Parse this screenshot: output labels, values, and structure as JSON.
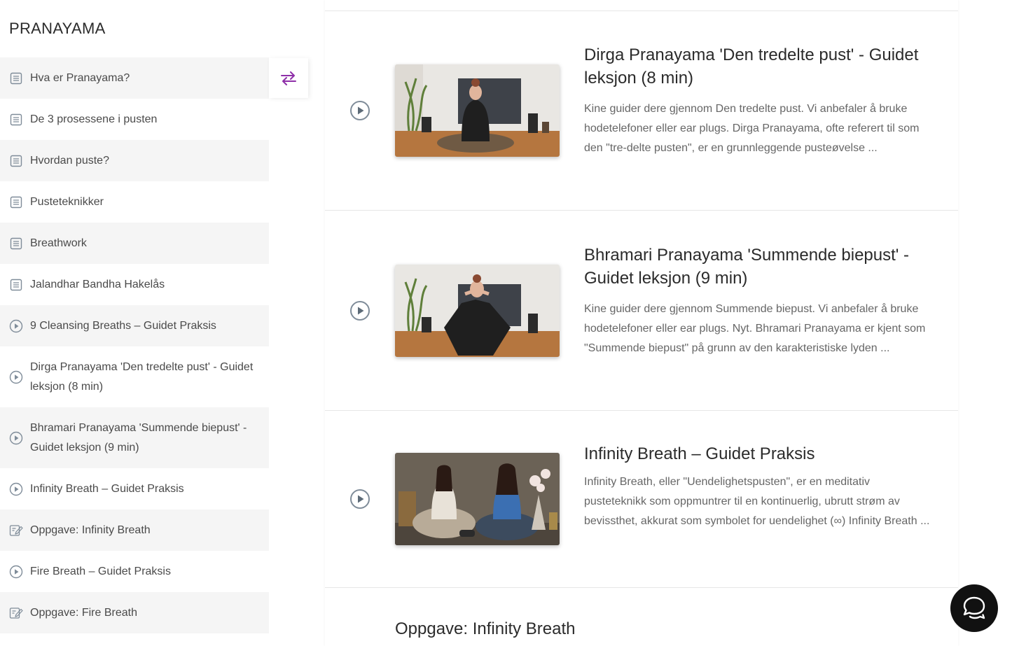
{
  "sidebar": {
    "title": "PRANAYAMA",
    "items": [
      {
        "label": "Hva er Pranayama?",
        "icon": "document-icon"
      },
      {
        "label": "De 3 prosessene i pusten",
        "icon": "document-icon"
      },
      {
        "label": "Hvordan puste?",
        "icon": "document-icon"
      },
      {
        "label": "Pusteteknikker",
        "icon": "document-icon"
      },
      {
        "label": "Breathwork",
        "icon": "document-icon"
      },
      {
        "label": "Jalandhar Bandha Hakelås",
        "icon": "document-icon"
      },
      {
        "label": "9 Cleansing Breaths – Guidet Praksis",
        "icon": "play-circle-icon"
      },
      {
        "label": "Dirga Pranayama 'Den tredelte pust' - Guidet leksjon (8 min)",
        "icon": "play-circle-icon"
      },
      {
        "label": "Bhramari Pranayama 'Summende biepust' - Guidet leksjon (9 min)",
        "icon": "play-circle-icon"
      },
      {
        "label": "Infinity Breath – Guidet Praksis",
        "icon": "play-circle-icon"
      },
      {
        "label": "Oppgave: Infinity Breath",
        "icon": "assignment-icon"
      },
      {
        "label": "Fire Breath – Guidet Praksis",
        "icon": "play-circle-icon"
      },
      {
        "label": "Oppgave: Fire Breath",
        "icon": "assignment-icon"
      }
    ]
  },
  "toggle": {
    "icon": "swap-arrows-icon",
    "color": "#8e2fa8"
  },
  "lessons": [
    {
      "title": "Dirga Pranayama 'Den tredelte pust' - Guidet leksjon (8 min)",
      "excerpt": "Kine guider dere gjennom Den tredelte pust.   Vi anbefaler å bruke hodetelefoner eller ear plugs. Dirga Pranayama, ofte referert til som den \"tre-delte pusten\", er en grunnleggende pusteøvelse ..."
    },
    {
      "title": "Bhramari Pranayama 'Summende biepust' - Guidet leksjon (9 min)",
      "excerpt": "Kine guider dere gjennom Summende biepust.   Vi anbefaler å bruke hodetelefoner eller ear plugs.   Nyt.   Bhramari Pranayama er kjent som \"Summende biepust\" på grunn av den karakteristiske lyden ..."
    },
    {
      "title": "Infinity Breath – Guidet Praksis",
      "excerpt": "Infinity Breath, eller \"Uendelighetspusten\", er en meditativ pusteteknikk som oppmuntrer til en kontinuerlig, ubrutt strøm av bevissthet, akkurat som symbolet for uendelighet (∞)   Infinity Breath ..."
    }
  ],
  "next_section_title": "Oppgave: Infinity Breath",
  "chat": {
    "icon": "chat-bubbles-icon"
  }
}
